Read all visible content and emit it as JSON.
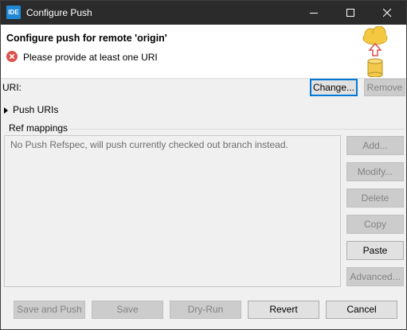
{
  "window": {
    "app_icon_text": "IDE",
    "title": "Configure Push"
  },
  "header": {
    "title": "Configure push for remote 'origin'",
    "error_message": "Please provide at least one URI"
  },
  "uri": {
    "label": "URI:",
    "change_label": "Change...",
    "remove_label": "Remove"
  },
  "push_uris": {
    "label": "Push URIs"
  },
  "ref_mappings": {
    "label": "Ref mappings",
    "empty_text": "No Push Refspec, will push currently checked out branch instead.",
    "buttons": {
      "add": "Add...",
      "modify": "Modify...",
      "delete": "Delete",
      "copy": "Copy",
      "paste": "Paste",
      "advanced": "Advanced..."
    }
  },
  "footer": {
    "save_and_push": "Save and Push",
    "save": "Save",
    "dry_run": "Dry-Run",
    "revert": "Revert",
    "cancel": "Cancel"
  },
  "colors": {
    "titlebar": "#2b2b2b",
    "accent": "#0078d7",
    "error": "#d9534f"
  }
}
